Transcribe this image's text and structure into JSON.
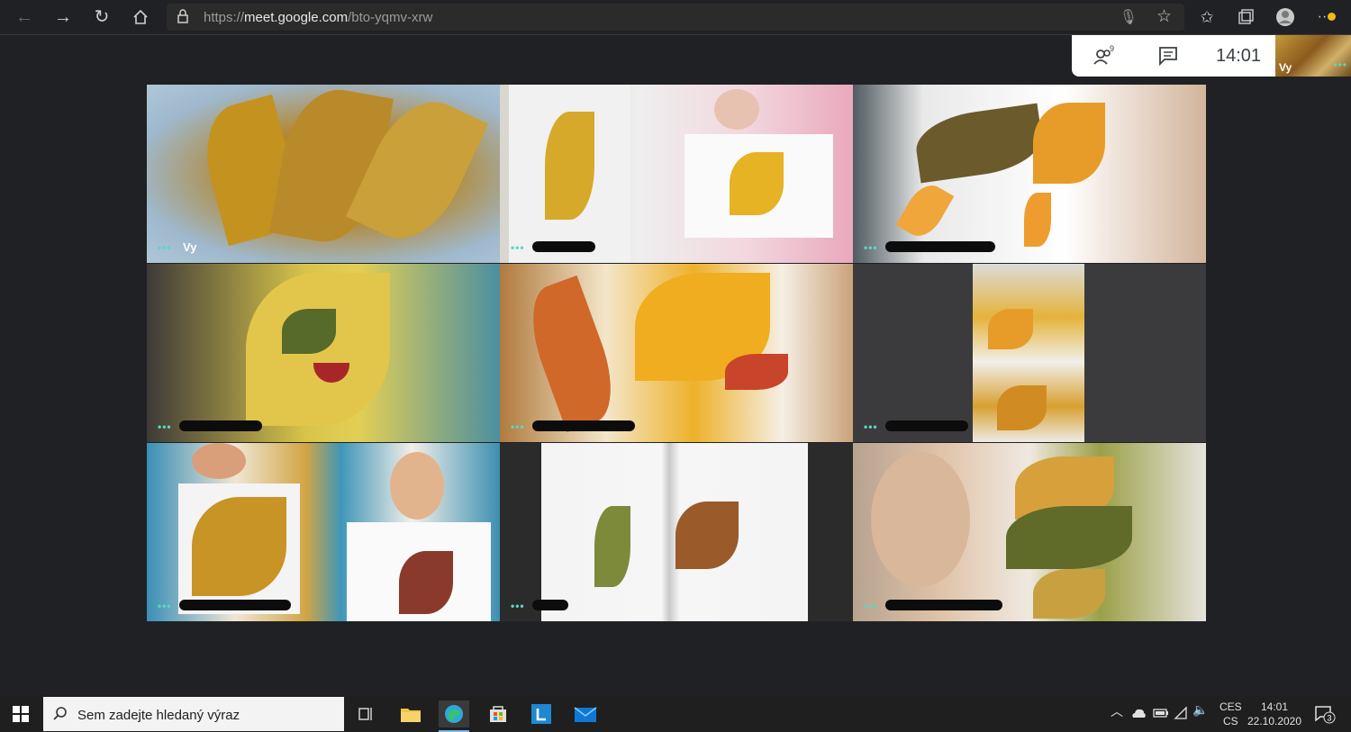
{
  "browser": {
    "url_prefix": "https://",
    "url_host": "meet.google.com",
    "url_path": "/bto-yqmv-xrw"
  },
  "meet": {
    "participant_count": "9",
    "time": "14:01",
    "self_label": "Vy",
    "tiles": [
      {
        "name": "Vy"
      },
      {
        "name": ""
      },
      {
        "name": ""
      },
      {
        "name": ""
      },
      {
        "name": ""
      },
      {
        "name": ""
      },
      {
        "name": ""
      },
      {
        "name": ""
      },
      {
        "name": ""
      }
    ]
  },
  "taskbar": {
    "search_placeholder": "Sem zadejte hledaný výraz",
    "lang_top": "CES",
    "lang_bottom": "CS",
    "time": "14:01",
    "date": "22.10.2020",
    "notification_count": "3"
  },
  "colors": {
    "meet_background": "#202124",
    "accent_dots": "#5dd6c0",
    "taskbar": "#1f1f1f"
  }
}
